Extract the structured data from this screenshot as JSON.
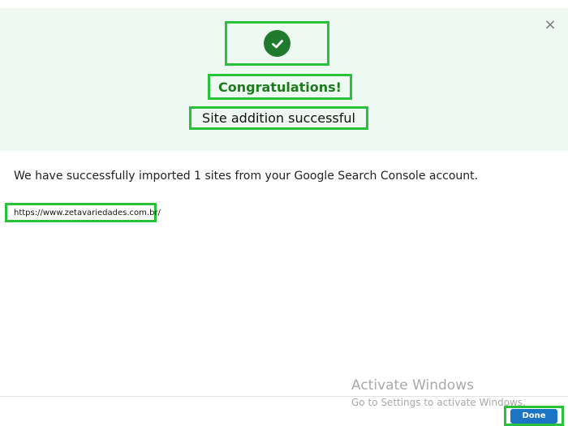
{
  "dialog": {
    "close_symbol": "×",
    "success_icon": "check-circle-icon",
    "title": "Congratulations!",
    "subtitle": "Site addition successful",
    "message": "We have successfully imported 1 sites from your Google Search Console account.",
    "imported_sites": [
      "https://www.zetavariedades.com.br/"
    ],
    "done_label": "Done"
  },
  "watermark": {
    "title": "Activate Windows",
    "subtitle": "Go to Settings to activate Windows."
  },
  "colors": {
    "header_background": "#eef9f2",
    "success_green": "#1f7a2e",
    "title_green": "#1d7b1d",
    "highlight_outline": "#27c23a",
    "primary_blue": "#1b74c4",
    "watermark_gray": "#a9a9a9"
  }
}
